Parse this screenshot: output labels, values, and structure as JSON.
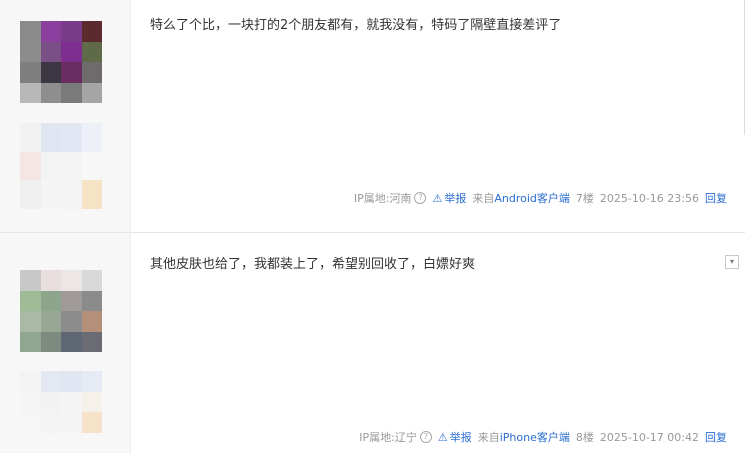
{
  "posts": [
    {
      "text": "特么了个比，一块打的2个朋友都有，就我没有，特码了隔壁直接差评了",
      "ip_label": "IP属地:河南",
      "report_label": "举报",
      "source_prefix": "来自",
      "source_link": "Android客户端",
      "floor": "7楼",
      "time": "2025-10-16 23:56",
      "reply_label": "回复",
      "avatar_colors": [
        "#8a8a8a",
        "#8a3f9e",
        "#7a3a8a",
        "#5a2a2e",
        "#8c8c8c",
        "#7a4f86",
        "#7e2e8f",
        "#5e6a48",
        "#7f7f7f",
        "#3d3743",
        "#6b2c62",
        "#6f6a6c",
        "#b8b8b8",
        "#8e8e8e",
        "#7a7a7a",
        "#a5a5a5"
      ],
      "blur_colors": [
        "#f2f2f2",
        "#dfe6f2",
        "#e2e8f3",
        "#eef0f7",
        "#f4e6e2",
        "#f3f3f3",
        "#f4f4f4",
        "#f7f7f7",
        "#f0f0f0",
        "#f4f4f4",
        "#f3f3f3",
        "#f6e3c6"
      ]
    },
    {
      "text": "其他皮肤也给了，我都装上了，希望别回收了，白嫖好爽",
      "ip_label": "IP属地:辽宁",
      "report_label": "举报",
      "source_prefix": "来自",
      "source_link": "iPhone客户端",
      "floor": "8楼",
      "time": "2025-10-17 00:42",
      "reply_label": "回复",
      "avatar_colors": [
        "#c8c8c8",
        "#e8dede",
        "#ece6e6",
        "#d9d9d9",
        "#9fbc96",
        "#8da58a",
        "#a09a98",
        "#8b8b8b",
        "#a9b9a6",
        "#98a694",
        "#8c8c8c",
        "#b48f7a",
        "#8fa691",
        "#7c8a80",
        "#5f6674",
        "#6b6b73"
      ],
      "blur_colors": [
        "#f3f3f3",
        "#e3e8f3",
        "#dfe5f1",
        "#e6eaf4",
        "#f5f5f5",
        "#f2f2f2",
        "#f4f4f4",
        "#f5f1ea",
        "#f6f6f6",
        "#f3f3f3",
        "#f4f4f4",
        "#f6e2c8"
      ]
    }
  ],
  "icons": {
    "help": "?",
    "warning": "⚠",
    "dropdown": "▾"
  }
}
